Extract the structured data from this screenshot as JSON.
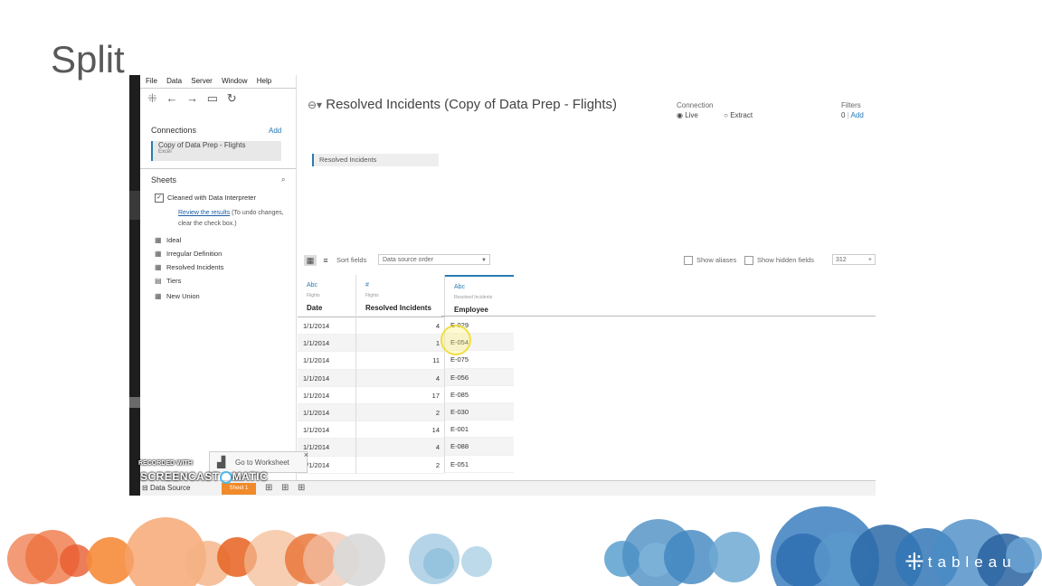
{
  "slide": {
    "title": "Split"
  },
  "menu": [
    "File",
    "Data",
    "Server",
    "Window",
    "Help"
  ],
  "toolbar": {
    "icons": [
      "tableau-logo-icon",
      "back-arrow-icon",
      "forward-arrow-icon",
      "save-icon",
      "refresh-icon"
    ],
    "logo": "⁜",
    "back": "←",
    "forward": "→",
    "save": "▭",
    "refresh": "↻"
  },
  "sidebar": {
    "connections_title": "Connections",
    "connections_add": "Add",
    "connection": {
      "name": "Copy of Data Prep - Flights",
      "type": "Excel"
    },
    "sheets_title": "Sheets",
    "interpreter_label": "Cleaned with Data Interpreter",
    "interpreter_link": "Review the results",
    "interpreter_note": "(To undo changes, clear the check box.)",
    "sheets": [
      {
        "label": "Ideal",
        "icon": "▦"
      },
      {
        "label": "Irregular Definition",
        "icon": "▦"
      },
      {
        "label": "Resolved Incidents",
        "icon": "▦"
      },
      {
        "label": "Tiers",
        "icon": "▤"
      },
      {
        "label": "New Union",
        "icon": "▦"
      }
    ]
  },
  "datasource": {
    "title": "Resolved Incidents (Copy of Data Prep - Flights)",
    "connection_label": "Connection",
    "live": "Live",
    "extract": "Extract",
    "filters_label": "Filters",
    "filters_count": "0",
    "filters_add": "Add",
    "canvas_table": "Resolved Incidents"
  },
  "gridbar": {
    "sort_label": "Sort fields",
    "sort_value": "Data source order",
    "show_aliases": "Show aliases",
    "show_hidden": "Show hidden fields",
    "rows": "312",
    "plus": "+"
  },
  "grid": {
    "columns": [
      {
        "type": "Abc",
        "source": "Flights",
        "name": "Date"
      },
      {
        "type": "#",
        "source": "Flights",
        "name": "Resolved Incidents"
      },
      {
        "type": "Abc",
        "source": "Resolved Incidents",
        "name": "Employee"
      }
    ],
    "rows": [
      [
        "1/1/2014",
        "4",
        "E-029"
      ],
      [
        "1/1/2014",
        "1",
        "E-054"
      ],
      [
        "1/1/2014",
        "11",
        "E-075"
      ],
      [
        "1/1/2014",
        "4",
        "E-056"
      ],
      [
        "1/1/2014",
        "17",
        "E-085"
      ],
      [
        "1/1/2014",
        "2",
        "E-030"
      ],
      [
        "1/1/2014",
        "14",
        "E-001"
      ],
      [
        "1/1/2014",
        "4",
        "E-088"
      ],
      [
        "1/1/2014",
        "2",
        "E-051"
      ]
    ]
  },
  "bottom": {
    "datasource_tab": "Data Source",
    "sheet_tab": "Sheet 1"
  },
  "goto": {
    "label": "Go to Worksheet",
    "close": "×"
  },
  "recording": {
    "line1": "RECORDED WITH",
    "line2a": "SCREENCAST",
    "line2b": "MATIC"
  },
  "logo": {
    "text": "tableau"
  },
  "colors": {
    "accent_blue": "#2a7ab0",
    "orange": "#f08a2a",
    "slide_title": "#595959"
  }
}
